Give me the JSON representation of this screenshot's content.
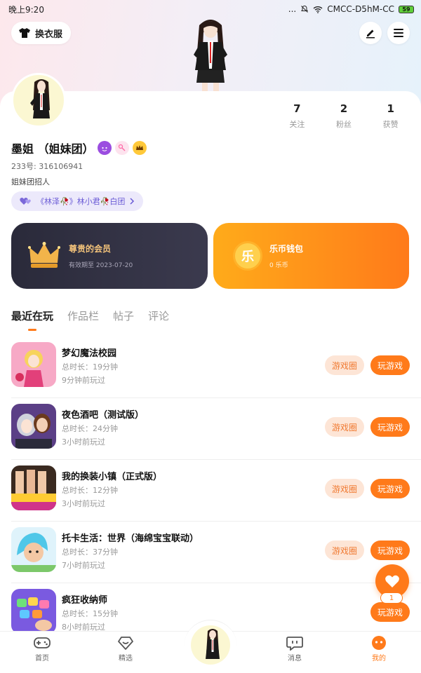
{
  "status_bar": {
    "time": "晚上9:20",
    "signal_dots": "...",
    "network": "CMCC-D5hM-CC",
    "battery": "59"
  },
  "header": {
    "outfit_button": "换衣服"
  },
  "profile": {
    "stats": [
      {
        "value": "7",
        "label": "关注"
      },
      {
        "value": "2",
        "label": "粉丝"
      },
      {
        "value": "1",
        "label": "获赞"
      }
    ],
    "name": "墨姐 （姐妹团）",
    "uid": "233号: 316106941",
    "bio": "姐妹团招人",
    "group_chip": "《林泽🥀》林小君🥀白团"
  },
  "cards": {
    "vip": {
      "title": "尊贵的会员",
      "subtitle": "有效期至 2023-07-20"
    },
    "wallet": {
      "title": "乐币钱包",
      "subtitle": "0 乐币",
      "icon_char": "乐"
    }
  },
  "tabs": [
    "最近在玩",
    "作品栏",
    "帖子",
    "评论"
  ],
  "games": [
    {
      "title": "梦幻魔法校园",
      "duration": "总时长：19分钟",
      "last_played": "9分钟前玩过",
      "circle_btn": "游戏圈",
      "play_btn": "玩游戏"
    },
    {
      "title": "夜色酒吧（测试版）",
      "duration": "总时长：24分钟",
      "last_played": "3小时前玩过",
      "circle_btn": "游戏圈",
      "play_btn": "玩游戏"
    },
    {
      "title": "我的换装小镇（正式版）",
      "duration": "总时长：12分钟",
      "last_played": "3小时前玩过",
      "circle_btn": "游戏圈",
      "play_btn": "玩游戏"
    },
    {
      "title": "托卡生活：世界（海绵宝宝联动）",
      "duration": "总时长：37分钟",
      "last_played": "7小时前玩过",
      "circle_btn": "游戏圈",
      "play_btn": "玩游戏"
    },
    {
      "title": "疯狂收纳师",
      "duration": "总时长：15分钟",
      "last_played": "8小时前玩过",
      "circle_btn": "",
      "play_btn": "玩游戏"
    }
  ],
  "like_fab": {
    "count": "1"
  },
  "bottom_nav": [
    {
      "label": "首页"
    },
    {
      "label": "精选"
    },
    {
      "label": "消息"
    },
    {
      "label": "我的"
    }
  ],
  "colors": {
    "accent": "#ff7a1a",
    "vip_bg": "#2a2a3a",
    "group_text": "#6a5bd6"
  }
}
